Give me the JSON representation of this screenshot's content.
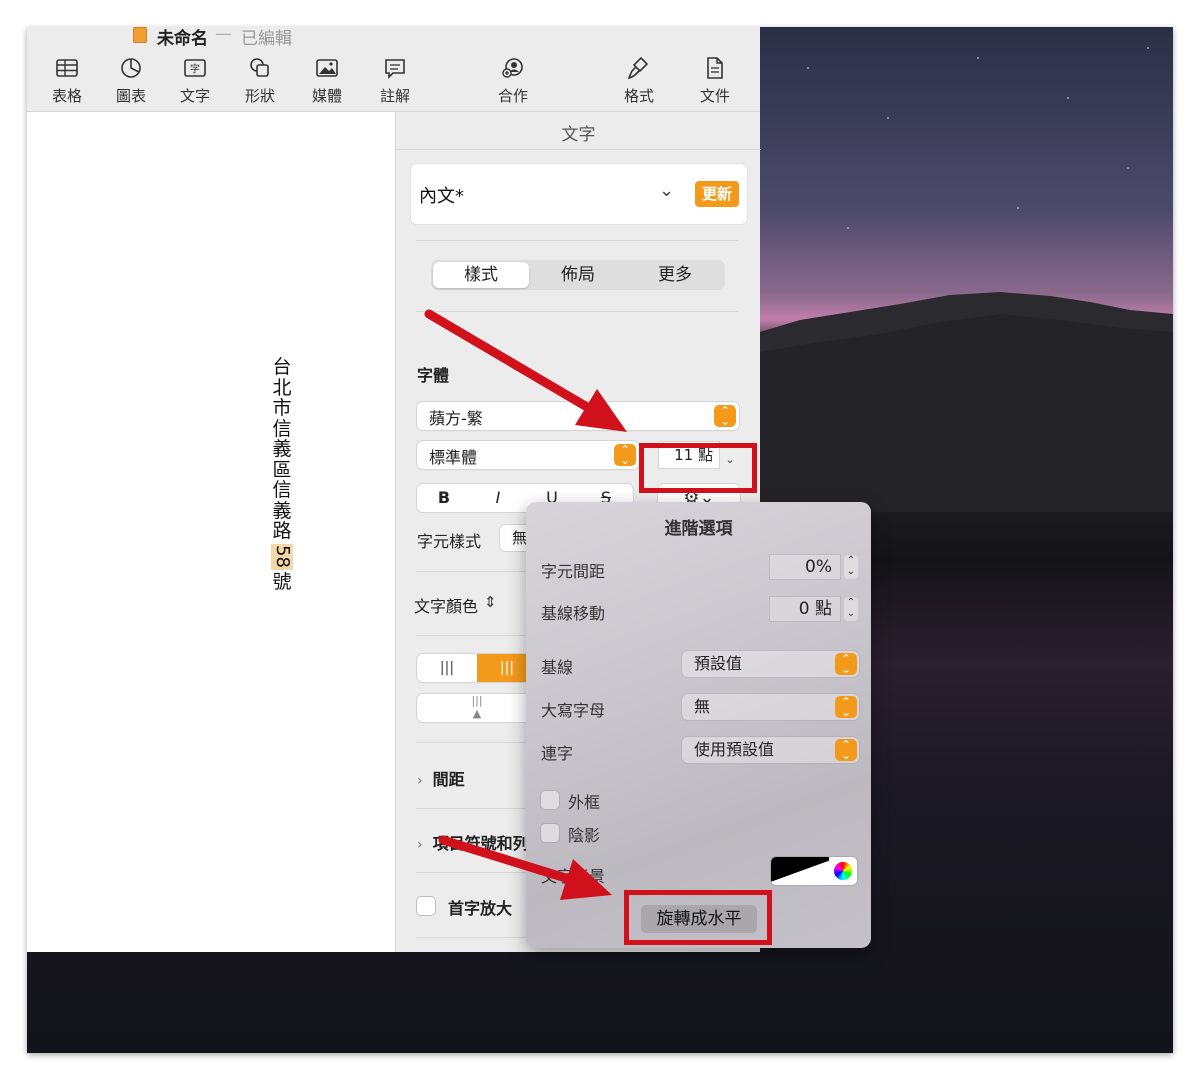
{
  "window": {
    "title": "未命名",
    "separator": "—",
    "status": "已編輯"
  },
  "toolbar": {
    "items": [
      {
        "label": "表格",
        "icon": "table-icon"
      },
      {
        "label": "圖表",
        "icon": "chart-icon"
      },
      {
        "label": "文字",
        "icon": "text-box-icon"
      },
      {
        "label": "形狀",
        "icon": "shape-icon"
      },
      {
        "label": "媒體",
        "icon": "media-icon"
      },
      {
        "label": "註解",
        "icon": "comment-icon"
      },
      {
        "label": "合作",
        "icon": "collaborate-icon"
      },
      {
        "label": "格式",
        "icon": "format-brush-icon"
      },
      {
        "label": "文件",
        "icon": "document-icon"
      }
    ]
  },
  "document": {
    "vertical_chars": [
      "台",
      "北",
      "市",
      "信",
      "義",
      "區",
      "信",
      "義",
      "路"
    ],
    "number": "58",
    "last_char": "號"
  },
  "sidebar": {
    "title": "文字",
    "paragraph_style": "內文*",
    "update_label": "更新",
    "tabs": [
      {
        "label": "樣式",
        "selected": true
      },
      {
        "label": "佈局",
        "selected": false
      },
      {
        "label": "更多",
        "selected": false
      }
    ],
    "font_section": "字體",
    "font_family": "蘋方-繁",
    "font_weight": "標準體",
    "font_size": "11 點",
    "format_buttons": [
      "B",
      "I",
      "U",
      "S"
    ],
    "gear_label": "⚙⌄",
    "char_style_label": "字元樣式",
    "char_style_value": "無",
    "text_color_label": "文字顏色",
    "spacing_label": "間距",
    "bullets_label": "項目符號和列表",
    "dropcap_label": "首字放大"
  },
  "advanced": {
    "title": "進階選項",
    "char_spacing_label": "字元間距",
    "char_spacing_value": "0%",
    "baseline_shift_label": "基線移動",
    "baseline_shift_value": "0 點",
    "baseline_label": "基線",
    "baseline_value": "預設值",
    "caps_label": "大寫字母",
    "caps_value": "無",
    "ligature_label": "連字",
    "ligature_value": "使用預設值",
    "outline_label": "外框",
    "shadow_label": "陰影",
    "text_bg_label": "文字背景",
    "rotate_label": "旋轉成水平"
  },
  "colors": {
    "accent": "#f39a1b",
    "annotation": "#d0111b"
  }
}
